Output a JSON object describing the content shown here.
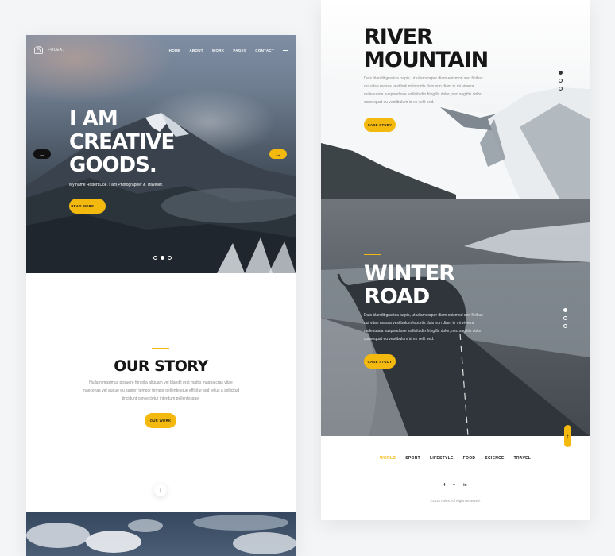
{
  "brand": {
    "logo_icon": "camera-icon",
    "name": "FOLEX."
  },
  "nav": {
    "items": [
      "HOME",
      "ABOUT",
      "WORK",
      "PAGES",
      "CONTACT"
    ],
    "menu_icon": "hamburger-icon"
  },
  "hero": {
    "title_lines": [
      "I AM",
      "CREATIVE",
      "GOODS."
    ],
    "subtitle": "My name Robert Doe. I am Photographer & Traveller.",
    "read_more": "READ MORE",
    "prev_arrow": "←",
    "next_arrow": "→",
    "slider_active": 2,
    "slider_count": 3
  },
  "story": {
    "title": "OUR STORY",
    "lines": [
      "Nullam maximus posuere fringilla aliquam vel blandit erat mattis magna cras vitae",
      "maecenas vel augue eu sapien tempor tempor pellentesque efficitur sed tellus a sollicitud",
      "tincidunt consectetur interdum pellentesque."
    ],
    "button": "OUR WORK",
    "scroll_arrow": "↓"
  },
  "projects": [
    {
      "title_lines": [
        "RIVER",
        "MOUNTAIN"
      ],
      "lines": [
        "Duis blandit gravida turpis, ut ullamcorper diam euismod sed finibus",
        "dui vitae massa vestibulum lobortis duis non diam in mi viverra",
        "malesuada suspendisse sollicitudin fringilla dolor, nec sagittis dolor",
        "consequat eu vestibulum id ex velit sed."
      ],
      "button": "CASE STUDY"
    },
    {
      "title_lines": [
        "WINTER",
        "ROAD"
      ],
      "lines": [
        "Duis blandit gravida turpis, ut ullamcorper diam euismod sed finibus",
        "dui vitae massa vestibulum lobortis duis non diam in mi viverra",
        "malesuada suspendisse sollicitudin fringilla dolor, nec sagittis dolor",
        "consequat eu vestibulum id ex velit sed."
      ],
      "button": "CASE STUDY"
    }
  ],
  "back_to_top": "↑",
  "categories": {
    "items": [
      "WORLD",
      "SPORT",
      "LIFESTYLE",
      "FOOD",
      "SCIENCE",
      "TRAVEL"
    ],
    "active": "WORLD"
  },
  "social": [
    "f",
    "♥",
    "in"
  ],
  "copyright": "©2016 Folex. All Right Reserved.",
  "colors": {
    "accent": "#f3b90f",
    "dark": "#161616"
  }
}
